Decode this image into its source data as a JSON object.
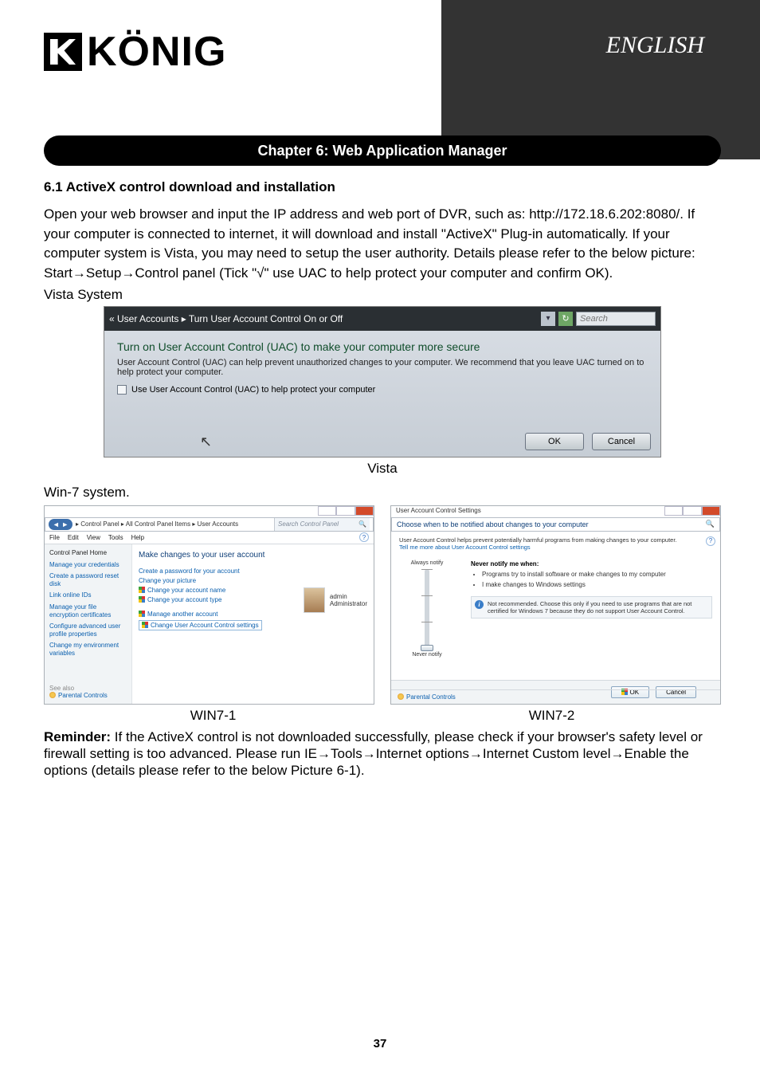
{
  "language": "ENGLISH",
  "logo_text": "KÖNIG",
  "chapter_title": "Chapter 6: Web Application Manager",
  "section_6_1_title": "6.1 ActiveX control download and installation",
  "intro_paragraph": "Open your web browser and input the IP address and web port of DVR, such as: http://172.18.6.202:8080/. If your computer is connected to internet, it will download and install \"ActiveX\" Plug-in automatically.  If your computer system is Vista, you may need to setup the user authority. Details please refer to the below picture: Start→Setup→Control panel (Tick \"√\" use UAC to help protect your computer and confirm OK).",
  "vista_system_label": "Vista System",
  "vista": {
    "breadcrumb_prefix": "«  User Accounts  ▸  Turn User Account Control On or Off",
    "search_placeholder": "Search",
    "heading": "Turn on User Account Control (UAC) to make your computer more secure",
    "desc": "User Account Control (UAC) can help prevent unauthorized changes to your computer.  We recommend that you leave UAC turned on to help protect your computer.",
    "checkbox_label": "Use User Account Control (UAC) to help protect your computer",
    "ok": "OK",
    "cancel": "Cancel"
  },
  "vista_caption": "Vista",
  "win7_system_label": "Win-7 system.",
  "win7_1": {
    "breadcrumb": "▸ Control Panel ▸ All Control Panel Items ▸ User Accounts",
    "search_placeholder": "Search Control Panel",
    "menu": [
      "File",
      "Edit",
      "View",
      "Tools",
      "Help"
    ],
    "sidebar_home": "Control Panel Home",
    "sidebar_links": [
      "Manage your credentials",
      "Create a password reset disk",
      "Link online IDs",
      "Manage your file encryption certificates",
      "Configure advanced user profile properties",
      "Change my environment variables"
    ],
    "see_also": "See also",
    "parental": "Parental Controls",
    "main_heading": "Make changes to your user account",
    "main_links": [
      "Create a password for your account",
      "Change your picture",
      "Change your account name",
      "Change your account type",
      "Manage another account",
      "Change User Account Control settings"
    ],
    "account_name": "admin",
    "account_role": "Administrator"
  },
  "win7_2": {
    "title": "User Account Control Settings",
    "header": "Choose when to be notified about changes to your computer",
    "desc": "User Account Control helps prevent potentially harmful programs from making changes to your computer.",
    "desc_link": "Tell me more about User Account Control settings",
    "slider_top": "Always notify",
    "slider_bottom": "Never notify",
    "never_heading": "Never notify me when:",
    "never_bullets": [
      "Programs try to install software or make changes to my computer",
      "I make changes to Windows settings"
    ],
    "infobox": "Not recommended. Choose this only if you need to use programs that are not certified for Windows 7 because they do not support User Account Control.",
    "ok": "OK",
    "cancel": "Cancel",
    "parental": "Parental Controls"
  },
  "caption_win7_1": "WIN7-1",
  "caption_win7_2": "WIN7-2",
  "reminder_label": "Reminder:",
  "reminder_text": " If the ActiveX control is not downloaded successfully, please check if your browser's safety level or firewall setting is too advanced. Please run IE→Tools→Internet options→Internet Custom level→Enable the options (details please refer to the below Picture 6-1).",
  "page_number": "37"
}
